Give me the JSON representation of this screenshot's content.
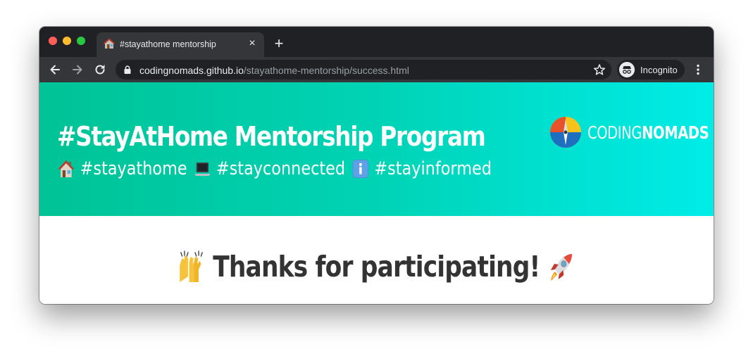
{
  "browser": {
    "tab": {
      "title": "#stayathome mentorship",
      "favicon": "house-emoji-icon",
      "close": "×"
    },
    "new_tab": "+",
    "url": {
      "host": "codingnomads.github.io",
      "path": "/stayathome-mentorship/success.html"
    },
    "profile_label": "Incognito"
  },
  "page": {
    "title": "#StayAtHome Mentorship Program",
    "hashtags": [
      {
        "icon": "house-emoji-icon",
        "text": "#stayathome"
      },
      {
        "icon": "laptop-emoji-icon",
        "text": "#stayconnected"
      },
      {
        "icon": "info-emoji-icon",
        "text": "#stayinformed"
      }
    ],
    "brand": {
      "light": "CODING",
      "bold": "NOMADS"
    },
    "thanks": "Thanks for participating!"
  },
  "colors": {
    "hero_gradient_start": "#00c396",
    "hero_gradient_end": "#00ece8",
    "chrome_dark": "#202124",
    "chrome_toolbar": "#35363a",
    "thanks_text": "#333333"
  }
}
